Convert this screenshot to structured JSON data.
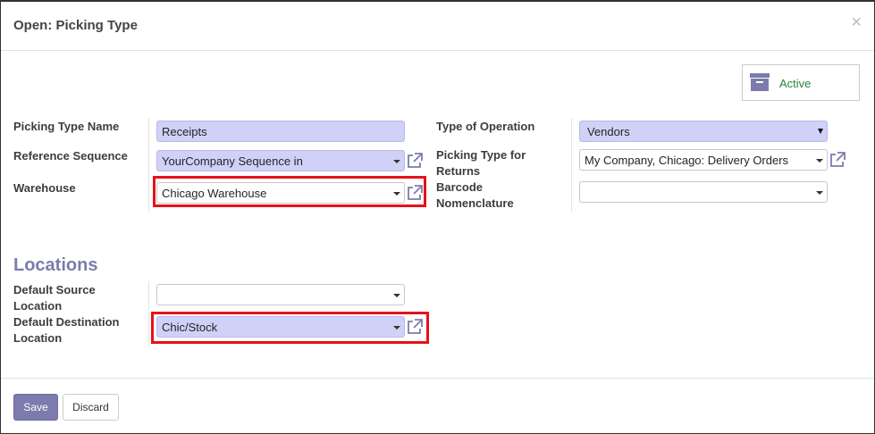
{
  "dialog": {
    "title": "Open: Picking Type",
    "close_symbol": "×"
  },
  "status": {
    "label": "Active",
    "icon": "archive-icon"
  },
  "fields": {
    "picking_type_name": {
      "label": "Picking Type Name",
      "value": "Receipts"
    },
    "reference_sequence": {
      "label": "Reference Sequence",
      "value": "YourCompany Sequence in"
    },
    "warehouse": {
      "label": "Warehouse",
      "value": "Chicago Warehouse"
    },
    "type_of_operation": {
      "label": "Type of Operation",
      "value": "Vendors"
    },
    "return_type": {
      "label_line1": "Picking Type for",
      "label_line2": "Returns",
      "value": "My Company, Chicago: Delivery Orders"
    },
    "barcode_nomenclature": {
      "label_line1": "Barcode",
      "label_line2": "Nomenclature",
      "value": ""
    }
  },
  "locations": {
    "section_title": "Locations",
    "default_source": {
      "label_line1": "Default Source",
      "label_line2": "Location",
      "value": ""
    },
    "default_destination": {
      "label_line1": "Default Destination",
      "label_line2": "Location",
      "value": "Chic/Stock"
    }
  },
  "footer": {
    "save_label": "Save",
    "discard_label": "Discard"
  },
  "colors": {
    "primary": "#7c7bad",
    "filled_field": "#d0d1f7",
    "highlight": "#e5121a",
    "active_text": "#28853b"
  }
}
